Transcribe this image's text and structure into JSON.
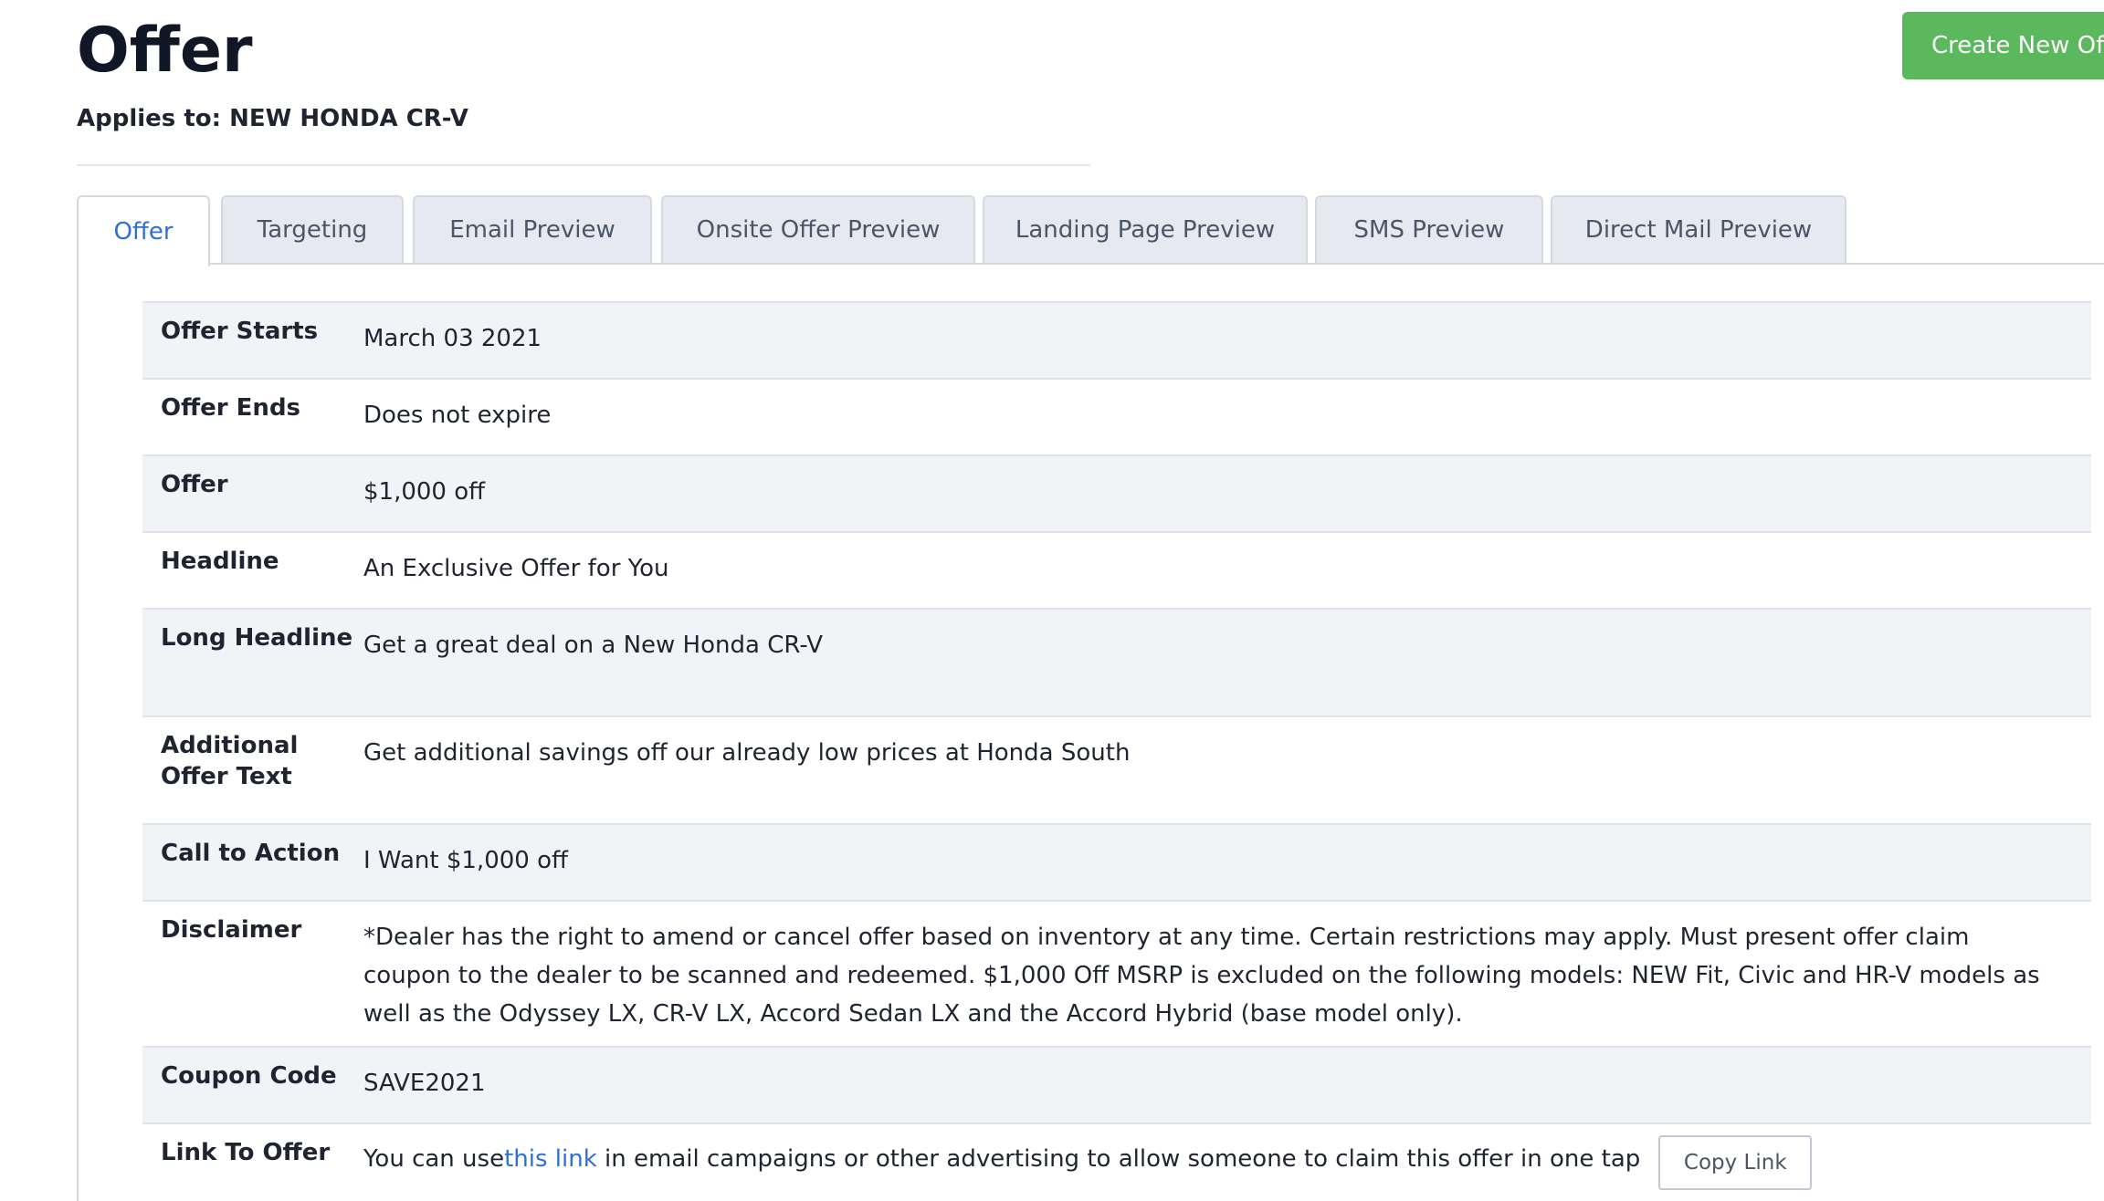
{
  "header": {
    "title": "Offer",
    "applies_to": "Applies to: NEW HONDA CR-V",
    "create_button_label": "Create New Offer"
  },
  "tabs": [
    {
      "label": "Offer",
      "active": true
    },
    {
      "label": "Targeting",
      "active": false
    },
    {
      "label": "Email Preview",
      "active": false
    },
    {
      "label": "Onsite Offer Preview",
      "active": false
    },
    {
      "label": "Landing Page Preview",
      "active": false
    },
    {
      "label": "SMS Preview",
      "active": false
    },
    {
      "label": "Direct Mail Preview",
      "active": false
    }
  ],
  "details": [
    {
      "label": "Offer Starts",
      "value": "March 03 2021"
    },
    {
      "label": "Offer Ends",
      "value": "Does not expire"
    },
    {
      "label": "Offer",
      "value": "$1,000 off"
    },
    {
      "label": "Headline",
      "value": "An Exclusive Offer for You"
    },
    {
      "label": "Long Headline",
      "value": "Get a great deal on a New Honda CR-V"
    },
    {
      "label": "Additional Offer Text",
      "value": "Get additional savings off our already low prices at Honda South"
    },
    {
      "label": "Call to Action",
      "value": "I Want $1,000 off"
    },
    {
      "label": "Disclaimer",
      "value": "*Dealer has the right to amend or cancel offer based on inventory at any time. Certain restrictions may apply. Must present offer claim coupon to the dealer to be scanned and redeemed. $1,000 Off MSRP is excluded on the following models: NEW Fit, Civic and HR-V models as well as the Odyssey LX, CR-V LX, Accord Sedan LX and the Accord Hybrid (base model only)."
    },
    {
      "label": "Coupon Code",
      "value": "SAVE2021"
    }
  ],
  "link_row": {
    "label": "Link To Offer",
    "text_before": "You can use ",
    "link_text": "this link",
    "text_after": " in email campaigns or other advertising to allow someone to claim this offer in one tap",
    "copy_button_label": "Copy Link"
  },
  "colors": {
    "primary_button": "#5cb85c",
    "link": "#2f6fd8",
    "row_stripe": "#f1f3f7"
  }
}
